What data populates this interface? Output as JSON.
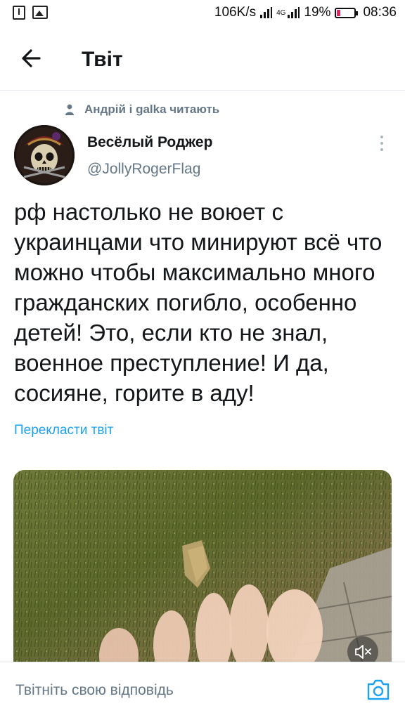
{
  "status_bar": {
    "network_speed": "106K/s",
    "signal_label": "4G",
    "battery_percent": "19%",
    "time": "08:36"
  },
  "header": {
    "title": "Твіт"
  },
  "social_context": {
    "text": "Андрій і galka читають"
  },
  "tweet": {
    "author_name": "Весёлый Роджер",
    "author_handle": "@JollyRogerFlag",
    "text": "рф настолько не воюет с украинцами что минируют всё что можно чтобы максимально много гражданских погибло, особенно детей! Это, если кто не знал, военное преступление! И да, сосияне, горите в аду!",
    "translate_label": "Перекласти твіт"
  },
  "reply_bar": {
    "placeholder": "Твітніть свою відповідь"
  },
  "colors": {
    "accent": "#1da1f2",
    "text_primary": "#14171a",
    "text_secondary": "#657786",
    "divider": "#e6ecf0"
  },
  "icons": {
    "back": "arrow-left-icon",
    "social": "person-icon",
    "more": "more-vertical-icon",
    "mute": "volume-muted-icon",
    "camera": "camera-icon"
  }
}
